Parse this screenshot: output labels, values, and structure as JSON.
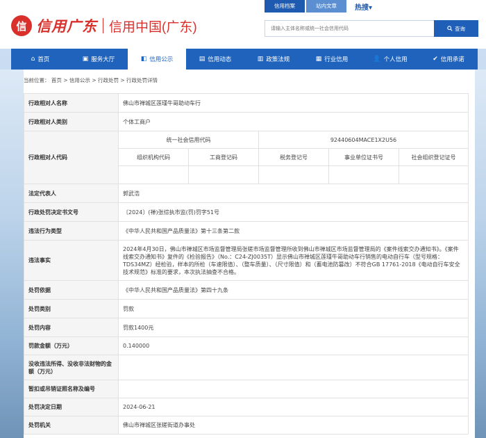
{
  "header": {
    "logo_mark": "信",
    "logo_script": "信用广东",
    "site_title": "信用中国(广东)",
    "top_tabs": [
      "信用档案",
      "站内文章"
    ],
    "hot_label": "热搜",
    "hot_arrow": "▾",
    "search": {
      "placeholder": "请输入主体名称或统一社会信用代码",
      "button": "查询"
    }
  },
  "nav": {
    "items": [
      {
        "label": "首页",
        "icon": "⌂"
      },
      {
        "label": "服务大厅",
        "icon": "▣"
      },
      {
        "label": "信用公示",
        "icon": "◧"
      },
      {
        "label": "信用动态",
        "icon": "▤"
      },
      {
        "label": "政策法规",
        "icon": "▥"
      },
      {
        "label": "行业信用",
        "icon": "▦"
      },
      {
        "label": "个人信用",
        "icon": "👤"
      },
      {
        "label": "信用承诺",
        "icon": "✔"
      }
    ],
    "active_index": 2
  },
  "breadcrumb": "当前位置： 首页 > 信用公示 > 行政处罚 > 行政处罚详情",
  "detail": {
    "counterparty_name": {
      "label": "行政相对人名称",
      "value": "佛山市禅城区莲瑾牛哥助动车行"
    },
    "counterparty_type": {
      "label": "行政相对人类别",
      "value": "个体工商户"
    },
    "counterparty_code": {
      "label": "行政相对人代码",
      "uscc_label": "统一社会信用代码",
      "uscc_value": "92440604MACE1X2U56",
      "sub_headers": [
        "组织机构代码",
        "工商登记码",
        "税务登记号",
        "事业单位证书号",
        "社会组织登记证号"
      ]
    },
    "legal_rep": {
      "label": "法定代表人",
      "value": "郭武浩"
    },
    "decision_no": {
      "label": "行政处罚决定书文号",
      "value": "〔2024〕(禅)张综执市监(罚)罚字51号"
    },
    "violation_type": {
      "label": "违法行为类型",
      "value": "《中华人民共和国产品质量法》第十三条第二款"
    },
    "violation_fact": {
      "label": "违法事实",
      "value": "2024年4月30日，佛山市禅城区市场监督管理局张槎市场监督管理所收到佛山市禅城区市场监督管理局的《案件线索交办通知书》。《案件线索交办通知书》复件的《检验报告》（No.：C24-ZJ0035T）显示佛山市禅城区莲瑾牛哥助动车行销售的电动自行车（型号规格：TDS34MZ）经检验，样本的所检（车速限值）、（整车质量）、（尺寸限值）和（蓄电池防篡改）不符合GB 17761-2018《电动自行车安全技术规范》标准的要求，本次执法抽查不合格。"
    },
    "penalty_basis": {
      "label": "处罚依据",
      "value": "《中华人民共和国产品质量法》第四十九条"
    },
    "penalty_category": {
      "label": "处罚类别",
      "value": "罚款"
    },
    "penalty_content": {
      "label": "处罚内容",
      "value": "罚款1400元"
    },
    "fine_amount": {
      "label": "罚款金额（万元）",
      "value": "0.140000"
    },
    "confiscated": {
      "label": "没收违法所得、没收非法财物的金额（万元）",
      "value": ""
    },
    "license_revoked": {
      "label": "暂扣或吊销证照名称及编号",
      "value": ""
    },
    "decision_date": {
      "label": "处罚决定日期",
      "value": "2024-06-21"
    },
    "authority": {
      "label": "处罚机关",
      "value": "佛山市禅城区张槎街道办事处"
    }
  },
  "colors": {
    "brand_red": "#d9302c",
    "nav_blue": "#1f63bd",
    "label_bg": "#f5f5f5"
  }
}
